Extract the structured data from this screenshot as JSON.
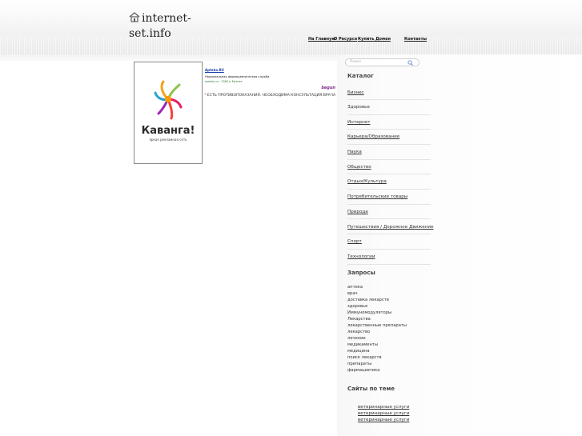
{
  "site": {
    "title_line1": "internet-",
    "title_line2": "set.info"
  },
  "topnav": [
    "На Главную",
    "О Ресурсе",
    "Купить Домен",
    "Контакты"
  ],
  "banner": {
    "brand": "Каванга!",
    "tagline": "яркая рекламная сеть"
  },
  "ad": {
    "title": "Apteka.RU",
    "description": "Национальная фармацевтическая служба",
    "url": "apteka.ru · СМИ и Бизнес",
    "network": "begun"
  },
  "warning": "ЕСТЬ ПРОТИВОПОКАЗАНИЯ. НЕОБХОДИМА КОНСУЛЬТАЦИЯ ВРАЧА",
  "search": {
    "placeholder": "Поиск"
  },
  "catalog": {
    "heading": "Каталог",
    "items": [
      "Бизнес",
      "Здоровье",
      "Интернет",
      "Карьера/Образование",
      "Наука",
      "Общество",
      "Отдых/Культура",
      "Потребительские товары",
      "Природа",
      "Путешествия / Дорожное Движение",
      "Спорт",
      "Технологии"
    ]
  },
  "queries": {
    "heading": "Запросы",
    "items": [
      "аптека",
      "врач",
      "доставка лекарств",
      "здоровье",
      "Иммуномодуляторы",
      "Лекарства",
      "лекарственные препараты",
      "лекарство",
      "лечение",
      "медикаменты",
      "медицина",
      "поиск лекарств",
      "препараты",
      "фармацевтика"
    ]
  },
  "related": {
    "heading": "Сайты по теме",
    "items": [
      "ветеринарные услуги",
      "ветеринарные услуги",
      "ветеринарные услуги"
    ]
  }
}
